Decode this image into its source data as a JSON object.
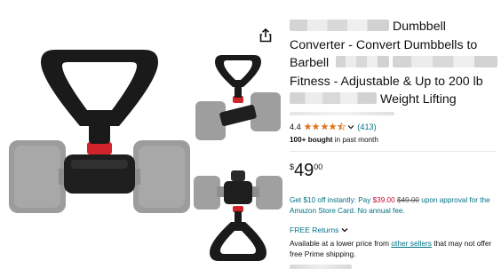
{
  "product": {
    "title_part1": "Dumbbell Converter - Convert Dumbbells to Barbell",
    "title_part2": "Fitness - Adjustable & Up to 200 lb",
    "title_part3": "Weight Lifting",
    "rating_value": "4.4",
    "star_count": 4.5,
    "review_count": "(413)",
    "bought_bold": "100+ bought",
    "bought_rest": " in past month"
  },
  "price": {
    "symbol": "$",
    "whole": "49",
    "fraction": "00"
  },
  "promo": {
    "part1": "Get $10 off instantly: Pay ",
    "new_price": "$39.00",
    "old_price": "$49.00",
    "part2": " upon approval for the Amazon Store Card. No annual fee."
  },
  "returns": {
    "label": "FREE Returns"
  },
  "availability": {
    "prefix": "Available at a lower price from ",
    "link": "other sellers",
    "suffix": " that may not offer free Prime shipping."
  },
  "icons": {
    "share": "share-icon",
    "star": "star-icon",
    "chevron": "chevron-down-icon"
  },
  "colors": {
    "link": "#007185",
    "star": "#de7921",
    "deal_red": "#cc0c39",
    "accent_ring": "#d0232a"
  }
}
